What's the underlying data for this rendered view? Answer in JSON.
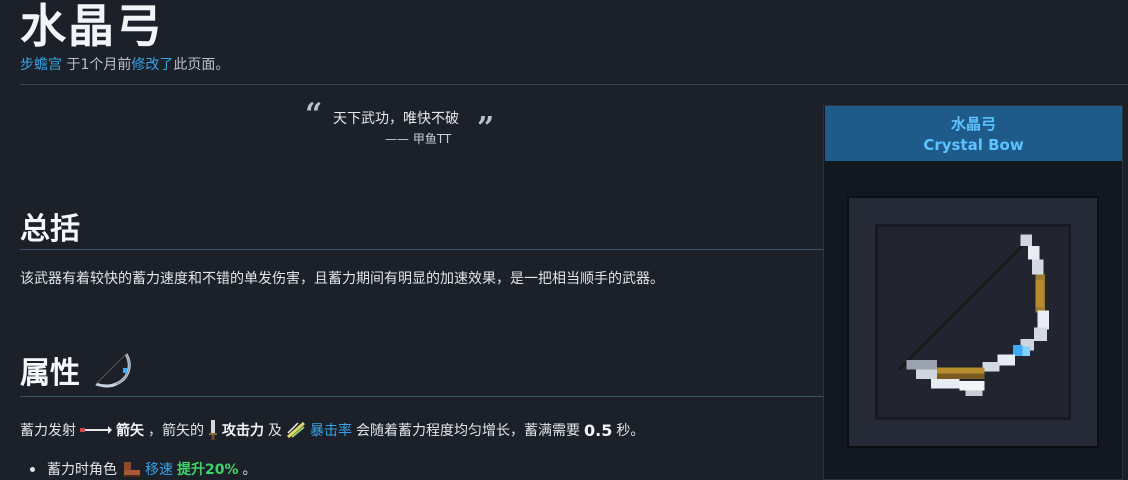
{
  "page": {
    "title": "水晶弓",
    "meta": {
      "author": "步蟾宫",
      "time_text": " 于1个月前",
      "action": "修改了",
      "suffix": "此页面。"
    }
  },
  "quote": {
    "open_mark": "“",
    "text": "天下武功，唯快不破",
    "close_mark": "”",
    "source": "—— 甲鱼TT"
  },
  "overview": {
    "heading": "总括",
    "text": "该武器有着较快的蓄力速度和不错的单发伤害，且蓄力期间有明显的加速效果，是一把相当顺手的武器。"
  },
  "attributes": {
    "heading": "属性",
    "line": {
      "part1": "蓄力发射",
      "arrow_label": "箭矢",
      "part2": "，箭矢的",
      "attack_label": "攻击力",
      "part3": "及",
      "crit_label": "暴击率",
      "part4": "会随着蓄力程度均匀增长，蓄满需要",
      "seconds": "0.5",
      "part5": "秒。"
    },
    "list": [
      {
        "prefix": "蓄力时角色",
        "stat_label": "移速",
        "boost": "提升20%",
        "suffix": "。"
      }
    ]
  },
  "sidebar": {
    "name": "水晶弓",
    "name_en": "Crystal Bow"
  },
  "icons": {
    "bow": "crystal-bow-icon",
    "arrow": "arrow-icon",
    "attack": "sword-icon",
    "crit": "crit-icon",
    "speed": "boot-icon"
  },
  "colors": {
    "link": "#38a3e8",
    "boost": "#3fd46a",
    "sidebar_header": "#1e5a8a"
  }
}
